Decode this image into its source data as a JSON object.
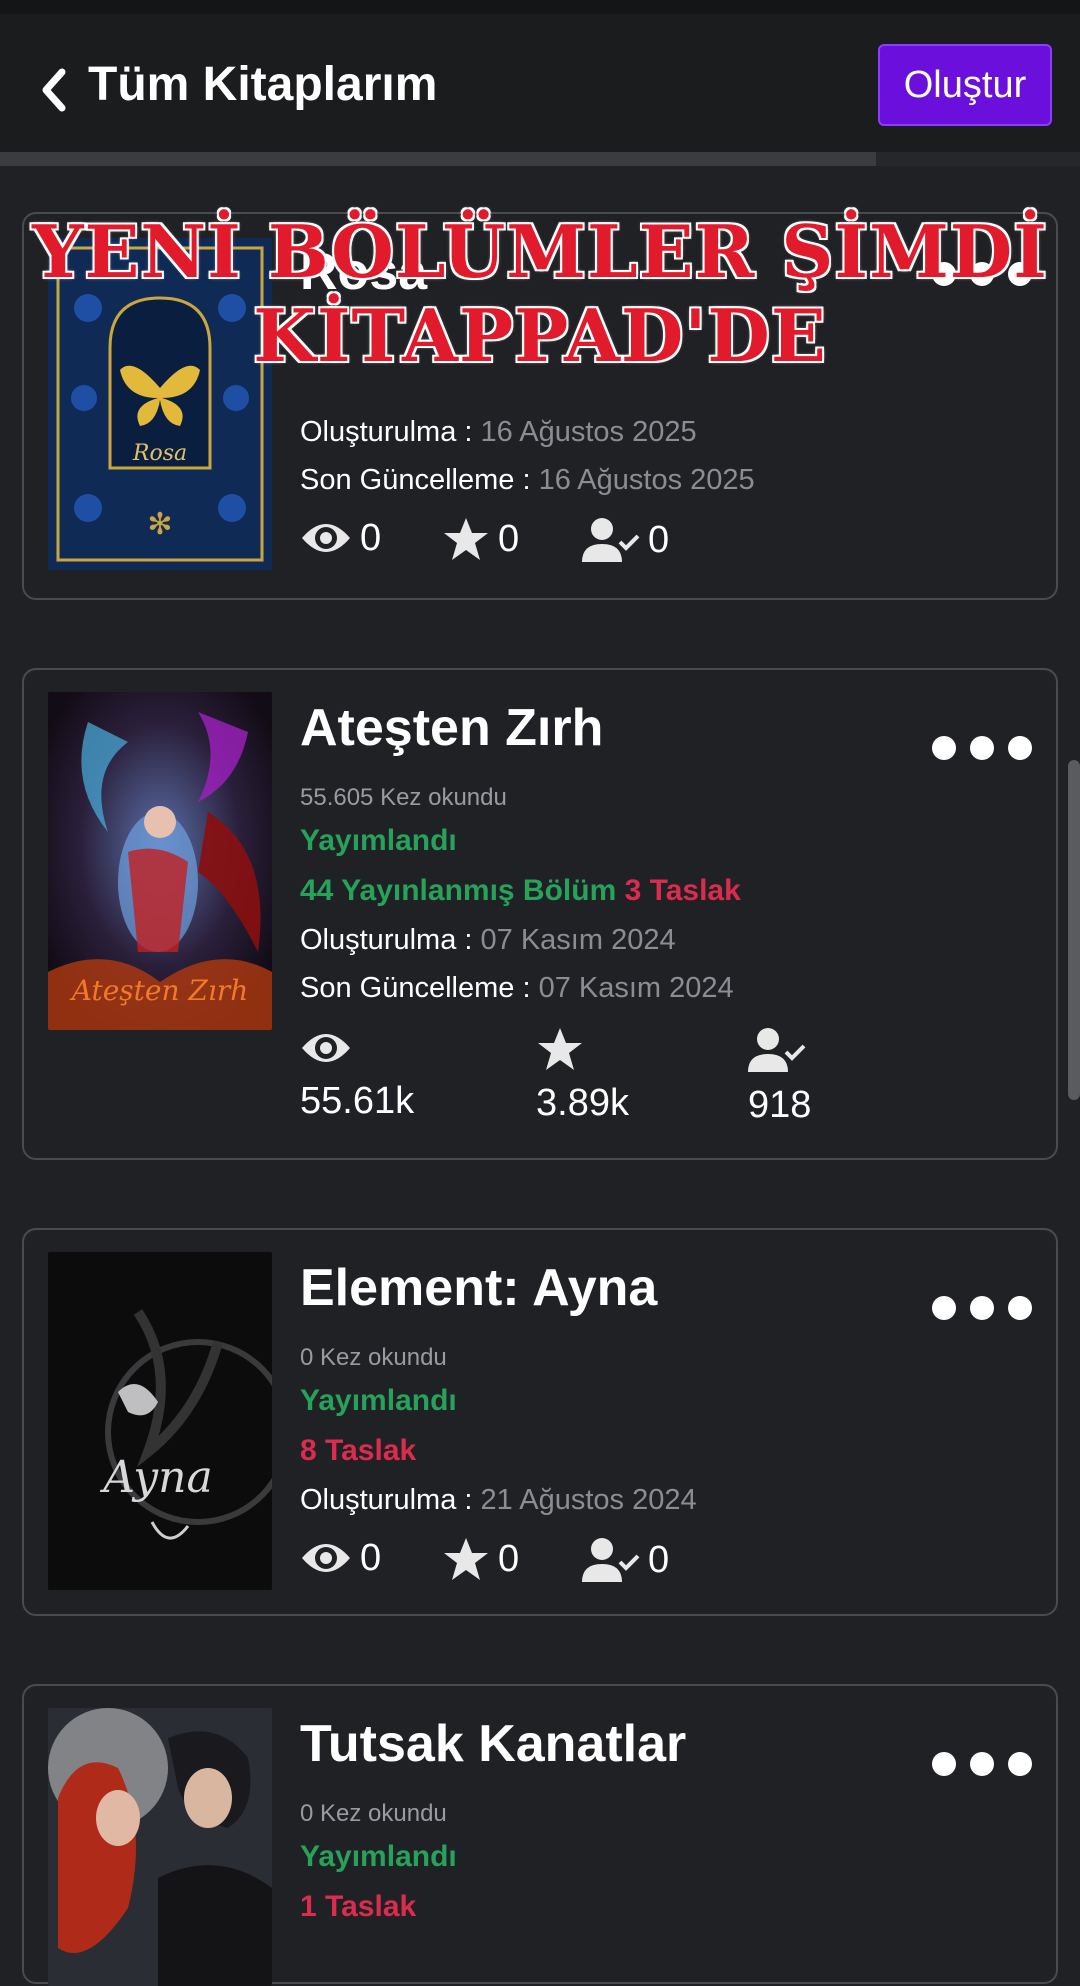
{
  "header": {
    "title": "Tüm Kitaplarım",
    "create_label": "Oluştur"
  },
  "banner": {
    "line1": "YENİ BÖLÜMLER ŞİMDİ",
    "line2": "KİTAPPAD'DE"
  },
  "books": [
    {
      "title": "Rosa",
      "cover_text": "Rosa",
      "created_label": "Oluşturulma :",
      "created": "16 Ağustos 2025",
      "updated_label": "Son Güncelleme :",
      "updated": "16 Ağustos 2025",
      "views": "0",
      "stars": "0",
      "followers": "0"
    },
    {
      "title": "Ateşten Zırh",
      "cover_text": "Ateşten Zırh",
      "reads": "55.605 Kez okundu",
      "status": "Yayımlandı",
      "published_chapters": "44 Yayınlanmış Bölüm",
      "drafts": "3 Taslak",
      "created_label": "Oluşturulma :",
      "created": "07 Kasım 2024",
      "updated_label": "Son Güncelleme :",
      "updated": "07 Kasım 2024",
      "views": "55.61k",
      "stars": "3.89k",
      "followers": "918"
    },
    {
      "title": "Element: Ayna",
      "cover_text": "Ayna",
      "reads": "0 Kez okundu",
      "status": "Yayımlandı",
      "drafts": "8 Taslak",
      "created_label": "Oluşturulma :",
      "created": "21 Ağustos 2024",
      "views": "0",
      "stars": "0",
      "followers": "0"
    },
    {
      "title": "Tutsak Kanatlar",
      "reads": "0 Kez okundu",
      "status": "Yayımlandı",
      "drafts": "1 Taslak"
    }
  ],
  "colors": {
    "background": "#202124",
    "accent": "#6a0fdc",
    "published_green": "#27a25a",
    "draft_red": "#dc2c4e",
    "banner_red": "#e11b2b"
  },
  "icons": [
    "chevron-left-icon",
    "more-horizontal-icon",
    "eye-icon",
    "star-icon",
    "user-check-icon"
  ]
}
